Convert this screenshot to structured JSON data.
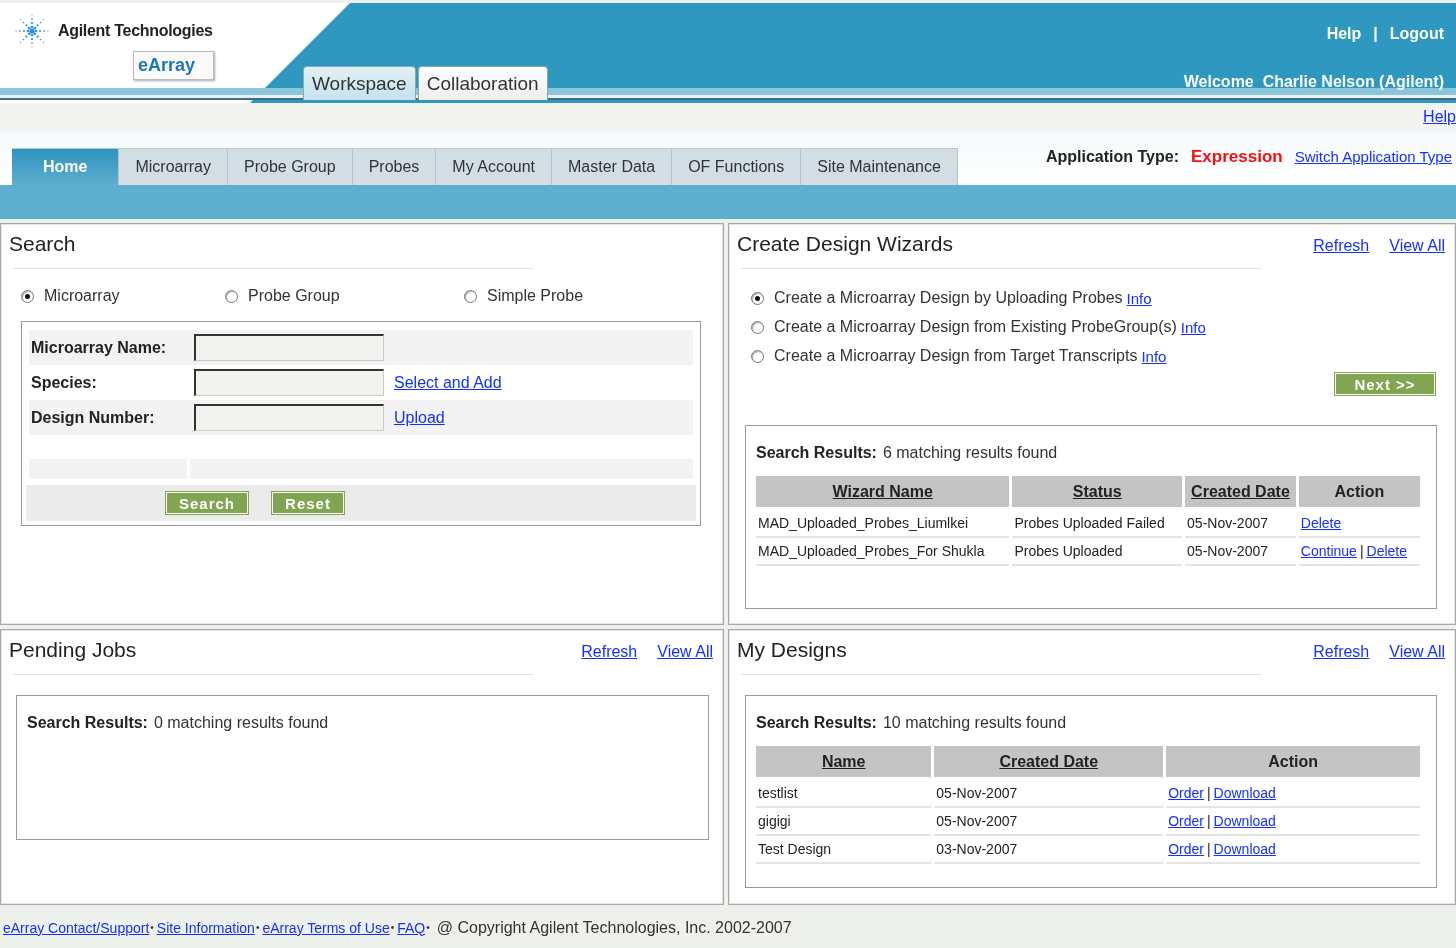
{
  "header": {
    "logo": {
      "company": "Agilent Technologies",
      "product": "eArray"
    },
    "top_tabs": [
      {
        "label": "Workspace",
        "selected": true
      },
      {
        "label": "Collaboration",
        "selected": false
      }
    ],
    "user_links": [
      "Help",
      "Logout"
    ],
    "user_links_separator": "|",
    "welcome": "Welcome  Charlie Nelson (Agilent)"
  },
  "subbar": {
    "help": "Help"
  },
  "nav": {
    "tabs": [
      {
        "label": "Home",
        "selected": true
      },
      {
        "label": "Microarray",
        "selected": false
      },
      {
        "label": "Probe Group",
        "selected": false
      },
      {
        "label": "Probes",
        "selected": false
      },
      {
        "label": "My Account",
        "selected": false
      },
      {
        "label": "Master Data",
        "selected": false
      },
      {
        "label": "OF Functions",
        "selected": false
      },
      {
        "label": "Site Maintenance",
        "selected": false
      }
    ],
    "application_type": {
      "label": "Application Type:",
      "value": "Expression",
      "switch_link": "Switch Application Type"
    }
  },
  "search": {
    "title": "Search",
    "options": [
      {
        "label": "Microarray",
        "selected": true
      },
      {
        "label": "Probe Group",
        "selected": false
      },
      {
        "label": "Simple Probe",
        "selected": false
      }
    ],
    "fields": [
      {
        "label": "Microarray Name:"
      },
      {
        "label": "Species:",
        "link": "Select and Add"
      },
      {
        "label": "Design Number:",
        "link": "Upload"
      }
    ],
    "buttons": [
      "Search",
      "Reset"
    ]
  },
  "wizards": {
    "title": "Create Design Wizards",
    "links": [
      "Refresh",
      "View All"
    ],
    "options": [
      {
        "label": "Create a Microarray Design by Uploading Probes",
        "info": "Info",
        "selected": true
      },
      {
        "label": "Create a Microarray Design from Existing ProbeGroup(s)",
        "info": "Info",
        "selected": false
      },
      {
        "label": "Create a Microarray Design from Target Transcripts",
        "info": "Info",
        "selected": false
      }
    ],
    "next": "Next >>",
    "results": {
      "label": "Search Results:",
      "summary": "6 matching results found",
      "columns": [
        {
          "label": "Wizard Name",
          "sortable": true
        },
        {
          "label": "Status",
          "sortable": true
        },
        {
          "label": "Created Date",
          "sortable": true
        },
        {
          "label": "Action",
          "sortable": false
        }
      ],
      "rows": [
        {
          "cells": [
            "MAD_Uploaded_Probes_Liumlkei",
            "Probes Uploaded Failed",
            "05-Nov-2007"
          ],
          "actions": [
            "Delete"
          ]
        },
        {
          "cells": [
            "MAD_Uploaded_Probes_For Shukla",
            "Probes Uploaded",
            "05-Nov-2007"
          ],
          "actions": [
            "Continue",
            "Delete"
          ],
          "separator": "|"
        }
      ]
    }
  },
  "pending_jobs": {
    "title": "Pending Jobs",
    "links": [
      "Refresh",
      "View All"
    ],
    "results": {
      "label": "Search Results:",
      "summary": "0 matching results found"
    }
  },
  "my_designs": {
    "title": "My Designs",
    "links": [
      "Refresh",
      "View All"
    ],
    "results": {
      "label": "Search Results:",
      "summary": "10 matching results found",
      "columns": [
        {
          "label": "Name",
          "sortable": true
        },
        {
          "label": "Created Date",
          "sortable": true
        },
        {
          "label": "Action",
          "sortable": false
        }
      ],
      "rows": [
        {
          "cells": [
            "testlist",
            "05-Nov-2007"
          ],
          "actions": [
            "Order",
            "Download"
          ],
          "separator": "|"
        },
        {
          "cells": [
            "gigigi",
            "05-Nov-2007"
          ],
          "actions": [
            "Order",
            "Download"
          ],
          "separator": "|"
        },
        {
          "cells": [
            "Test Design",
            "03-Nov-2007"
          ],
          "actions": [
            "Order",
            "Download"
          ],
          "separator": "|"
        }
      ]
    }
  },
  "footer": {
    "links": [
      {
        "label": "eArray Contact/Support",
        "separator": "•"
      },
      {
        "label": "Site Information",
        "separator": "•"
      },
      {
        "label": "eArray Terms of Use",
        "separator": "•"
      },
      {
        "label": "FAQ",
        "separator": "•"
      }
    ],
    "copyright": "@ Copyright Agilent Technologies, Inc. 2002-2007"
  }
}
